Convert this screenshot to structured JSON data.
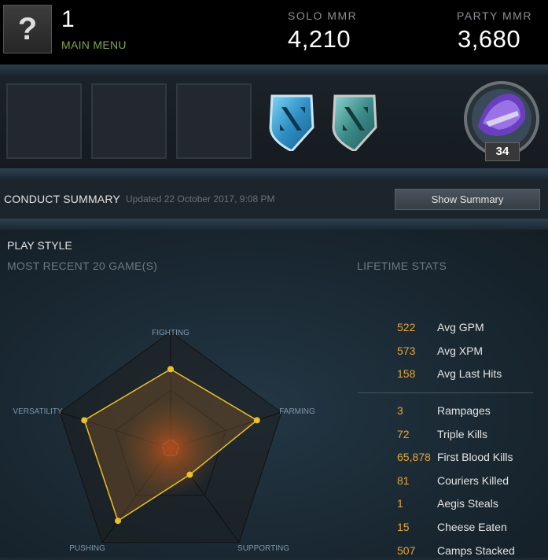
{
  "header": {
    "avatar_glyph": "?",
    "player_name": "1",
    "main_menu_label": "MAIN MENU",
    "solo_mmr_label": "SOLO MMR",
    "solo_mmr_value": "4,210",
    "party_mmr_label": "PARTY MMR",
    "party_mmr_value": "3,680"
  },
  "medals": {
    "badges": [
      "dota-logo-badge-blue",
      "dota-logo-badge-teal"
    ],
    "level": "34"
  },
  "conduct": {
    "title": "CONDUCT SUMMARY",
    "updated": "Updated 22 October 2017, 9:08 PM",
    "button_label": "Show Summary"
  },
  "play_style": {
    "title": "PLAY STYLE",
    "recent_label": "MOST RECENT 20 GAME(S)",
    "lifetime_label": "LIFETIME STATS",
    "axes": [
      "FIGHTING",
      "FARMING",
      "SUPPORTING",
      "PUSHING",
      "VERSATILITY"
    ],
    "values": [
      0.68,
      0.78,
      0.28,
      0.77,
      0.78
    ]
  },
  "lifetime_stats": {
    "averages": [
      {
        "value": "522",
        "label": "Avg GPM"
      },
      {
        "value": "573",
        "label": "Avg XPM"
      },
      {
        "value": "158",
        "label": "Avg Last Hits"
      }
    ],
    "totals": [
      {
        "value": "3",
        "label": "Rampages"
      },
      {
        "value": "72",
        "label": "Triple Kills"
      },
      {
        "value": "65,878",
        "label": "First Blood Kills"
      },
      {
        "value": "81",
        "label": "Couriers Killed"
      },
      {
        "value": "1",
        "label": "Aegis Steals"
      },
      {
        "value": "15",
        "label": "Cheese Eaten"
      },
      {
        "value": "507",
        "label": "Camps Stacked"
      }
    ]
  },
  "colors": {
    "accent_green": "#7da946",
    "stat_orange": "#e7a638",
    "radar_yellow": "#e8c22a"
  }
}
